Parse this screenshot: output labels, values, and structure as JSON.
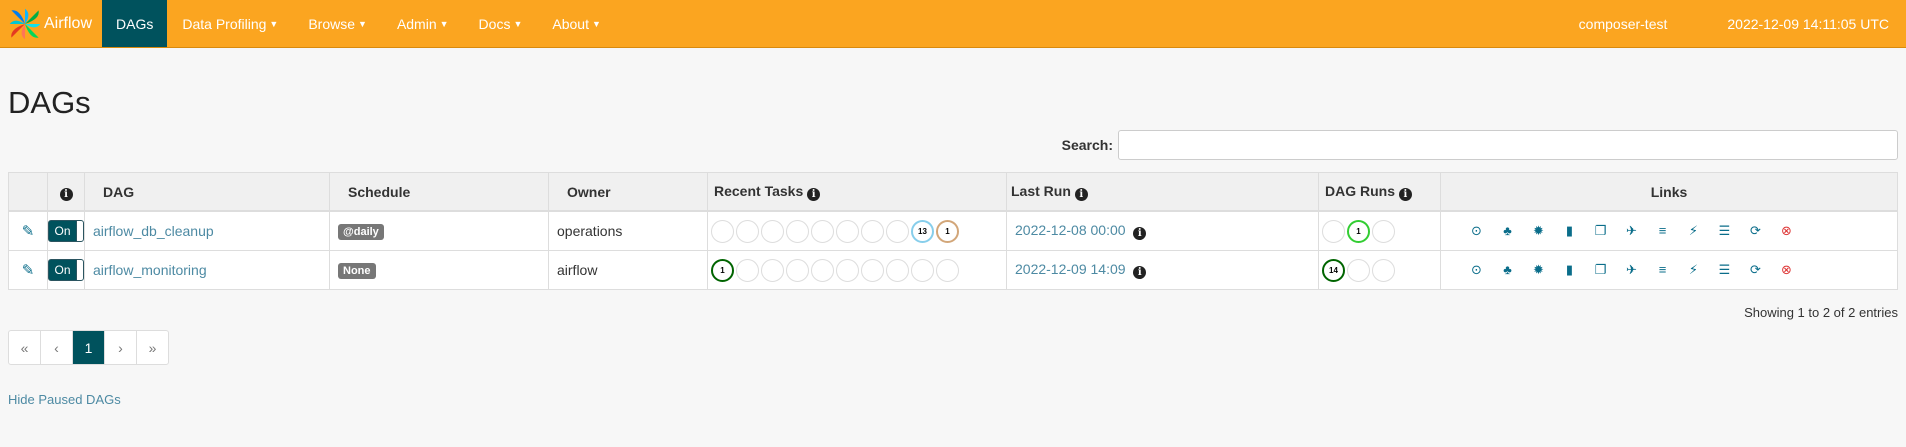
{
  "nav": {
    "brand": "Airflow",
    "items": [
      {
        "label": "DAGs",
        "active": true
      },
      {
        "label": "Data Profiling",
        "active": false
      },
      {
        "label": "Browse",
        "active": false
      },
      {
        "label": "Admin",
        "active": false
      },
      {
        "label": "Docs",
        "active": false
      },
      {
        "label": "About",
        "active": false
      }
    ],
    "environment": "composer-test",
    "clock": "2022-12-09 14:11:05 UTC"
  },
  "page_title": "DAGs",
  "search": {
    "label": "Search:",
    "value": ""
  },
  "table": {
    "headers": {
      "dag": "DAG",
      "schedule": "Schedule",
      "owner": "Owner",
      "recent_tasks": "Recent Tasks",
      "last_run": "Last Run",
      "dag_runs": "DAG Runs",
      "links": "Links"
    },
    "rows": [
      {
        "toggle": "On",
        "dag": "airflow_db_cleanup",
        "schedule": "@daily",
        "owner": "operations",
        "recent_tasks": [
          {
            "count": "",
            "color": ""
          },
          {
            "count": "",
            "color": ""
          },
          {
            "count": "",
            "color": ""
          },
          {
            "count": "",
            "color": ""
          },
          {
            "count": "",
            "color": ""
          },
          {
            "count": "",
            "color": ""
          },
          {
            "count": "",
            "color": ""
          },
          {
            "count": "",
            "color": ""
          },
          {
            "count": "13",
            "color": "#87ceeb"
          },
          {
            "count": "1",
            "color": "#d2a679"
          }
        ],
        "last_run": "2022-12-08 00:00",
        "dag_runs": [
          {
            "count": "",
            "color": ""
          },
          {
            "count": "1",
            "color": "#32cd32"
          },
          {
            "count": "",
            "color": ""
          }
        ]
      },
      {
        "toggle": "On",
        "dag": "airflow_monitoring",
        "schedule": "None",
        "owner": "airflow",
        "recent_tasks": [
          {
            "count": "1",
            "color": "#006400"
          },
          {
            "count": "",
            "color": ""
          },
          {
            "count": "",
            "color": ""
          },
          {
            "count": "",
            "color": ""
          },
          {
            "count": "",
            "color": ""
          },
          {
            "count": "",
            "color": ""
          },
          {
            "count": "",
            "color": ""
          },
          {
            "count": "",
            "color": ""
          },
          {
            "count": "",
            "color": ""
          },
          {
            "count": "",
            "color": ""
          }
        ],
        "last_run": "2022-12-09 14:09",
        "dag_runs": [
          {
            "count": "14",
            "color": "#006400"
          },
          {
            "count": "",
            "color": ""
          },
          {
            "count": "",
            "color": ""
          }
        ]
      }
    ],
    "link_icons": [
      "trigger-dag-icon",
      "tree-view-icon",
      "graph-view-icon",
      "duration-icon",
      "task-tries-icon",
      "landing-times-icon",
      "gantt-icon",
      "code-icon",
      "logs-icon",
      "refresh-icon",
      "delete-icon"
    ]
  },
  "footer": {
    "showing": "Showing 1 to 2 of 2 entries",
    "pager": [
      "«",
      "‹",
      "1",
      "›",
      "»"
    ],
    "current_page": "1",
    "hide_paused": "Hide Paused DAGs"
  },
  "colors": {
    "navbar": "#fba520",
    "active": "#00525d",
    "link": "#4d8aa3"
  }
}
